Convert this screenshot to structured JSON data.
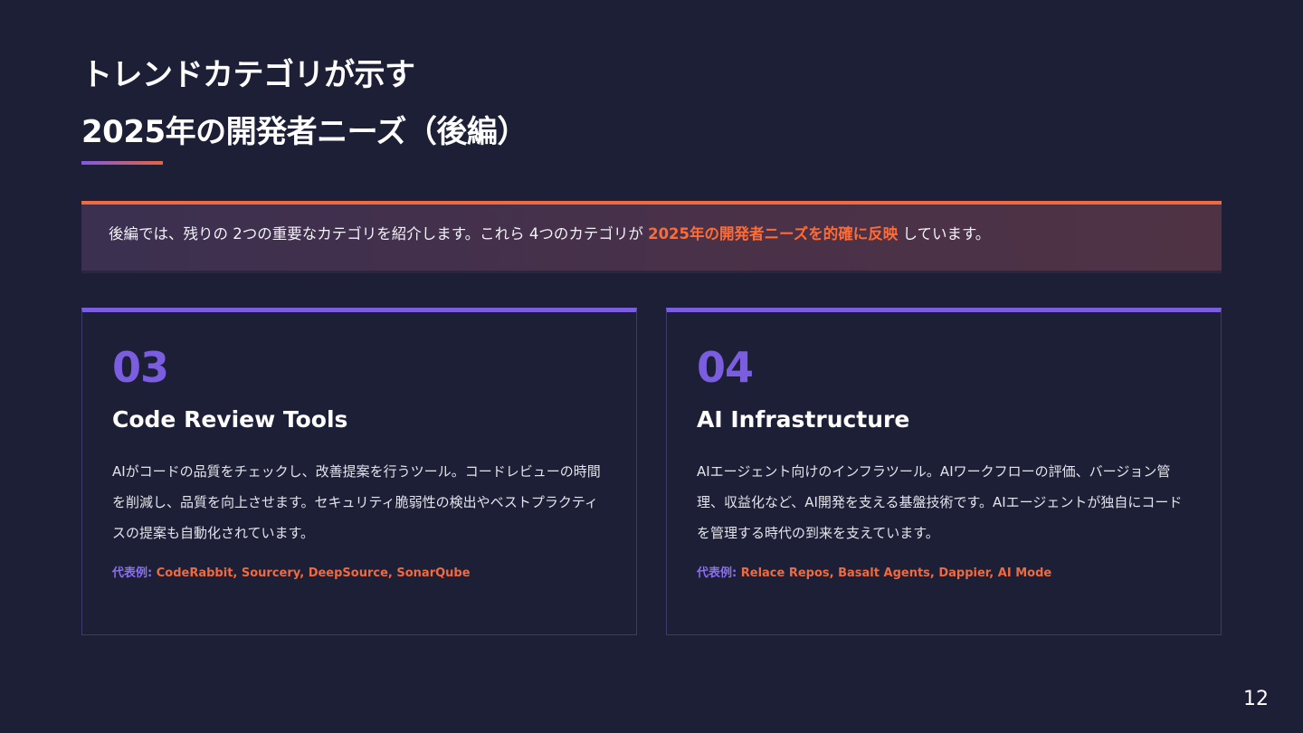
{
  "slide": {
    "title_line1": "トレンドカテゴリが示す",
    "title_line2": "2025年の開発者ニーズ（後編）",
    "accent_colors": {
      "orange": "#f06a3f",
      "purple": "#7b5ee0",
      "background": "#1c1f35"
    },
    "intro": {
      "text_before": "後編では、残りの 2つの重要なカテゴリを紹介します。これら  4つのカテゴリが ",
      "highlight": "2025年の開発者ニーズを的確に反映",
      "text_after": "  しています。"
    },
    "cards": [
      {
        "number": "03",
        "title": "Code Review Tools",
        "description": "AIがコードの品質をチェックし、改善提案を行うツール。コードレビューの時間を削減し、品質を向上させます。セキュリティ脆弱性の検出やベストプラクティスの提案も自動化されています。",
        "examples_label": "代表例",
        "examples": "CodeRabbit, Sourcery, DeepSource, SonarQube"
      },
      {
        "number": "04",
        "title": "AI Infrastructure",
        "description": "AIエージェント向けのインフラツール。AIワークフローの評価、バージョン管理、収益化など、AI開発を支える基盤技術です。AIエージェントが独自にコードを管理する時代の到来を支えています。",
        "examples_label": "代表例",
        "examples": "Relace Repos, Basalt Agents, Dappier, AI Mode"
      }
    ],
    "page_number": "12"
  }
}
